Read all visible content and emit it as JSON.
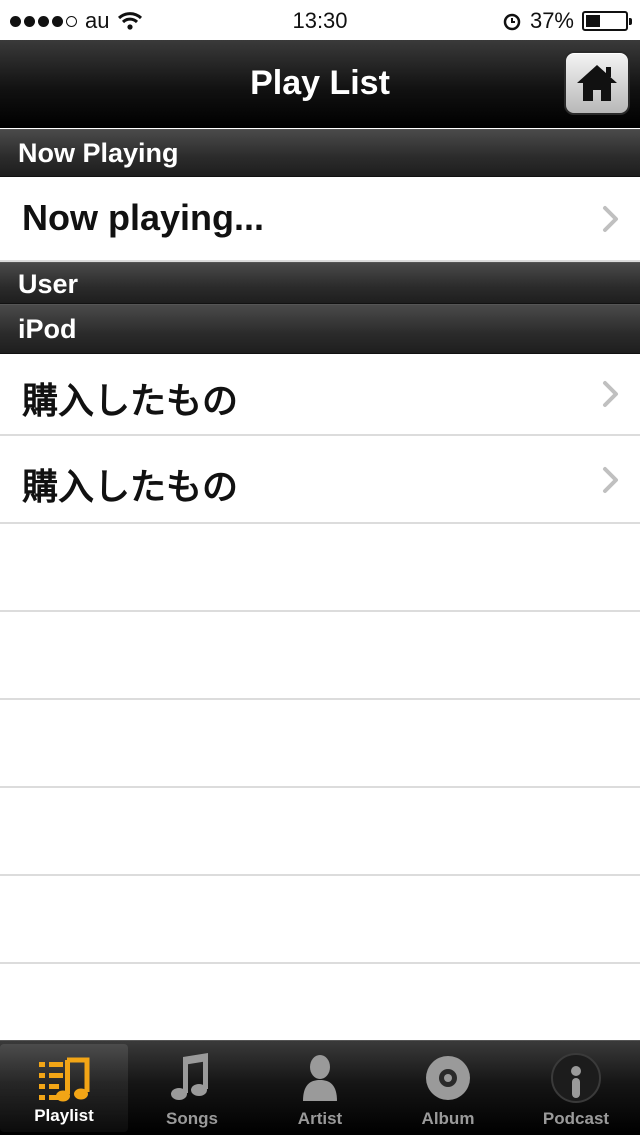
{
  "status_bar": {
    "carrier": "au",
    "time": "13:30",
    "battery": "37%",
    "battery_level": 0.37
  },
  "nav": {
    "title": "Play List",
    "home_icon": "home-icon"
  },
  "sections": {
    "now_playing_header": "Now Playing",
    "now_playing_item": "Now playing...",
    "user_header": "User",
    "ipod_header": "iPod",
    "ipod_items": [
      "購入したもの",
      "購入したもの"
    ]
  },
  "tab_bar": {
    "tabs": [
      {
        "label": "Playlist",
        "icon": "playlist-icon",
        "active": true
      },
      {
        "label": "Songs",
        "icon": "music-note-icon",
        "active": false
      },
      {
        "label": "Artist",
        "icon": "artist-icon",
        "active": false
      },
      {
        "label": "Album",
        "icon": "album-disc-icon",
        "active": false
      },
      {
        "label": "Podcast",
        "icon": "podcast-icon",
        "active": false
      }
    ]
  },
  "colors": {
    "accent_active_tab": "#f2a516",
    "header_bg": "#2b2b2b",
    "separator": "#dcdcdc"
  }
}
